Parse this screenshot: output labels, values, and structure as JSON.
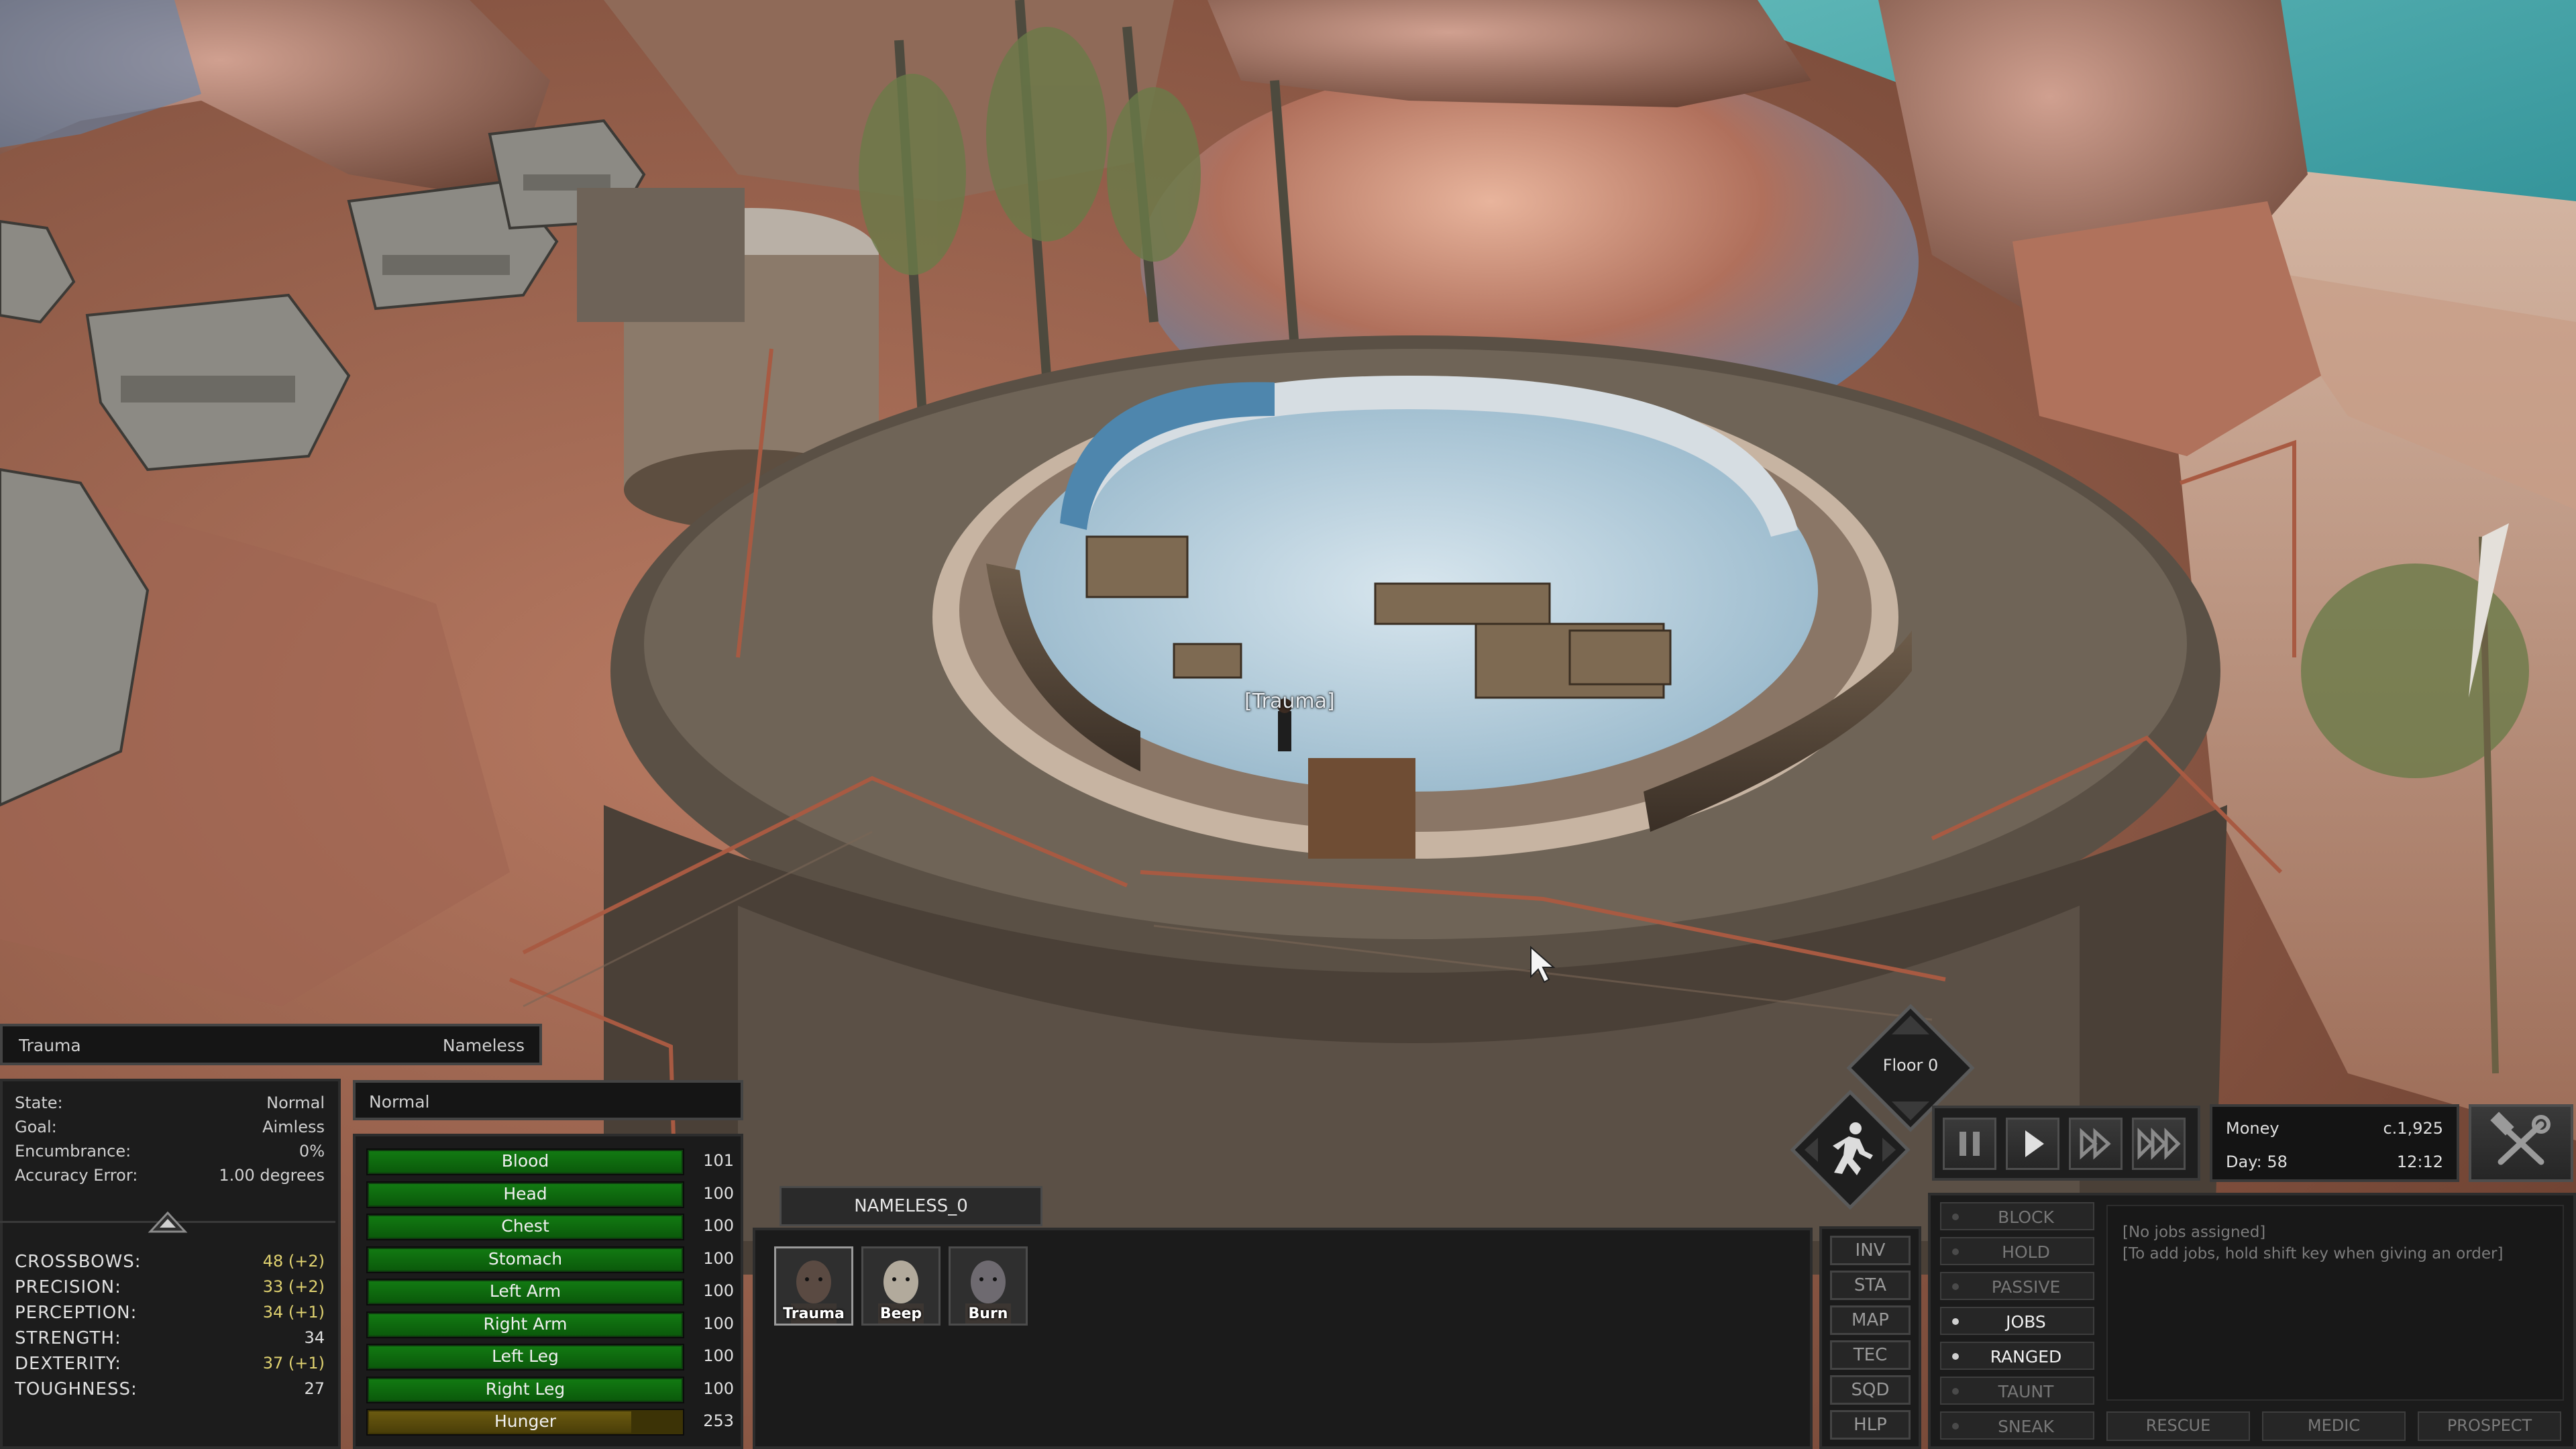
{
  "world": {
    "hover_label": "[Trauma]"
  },
  "character": {
    "name": "Trauma",
    "faction": "Nameless",
    "stats": [
      {
        "key": "State:",
        "value": "Normal"
      },
      {
        "key": "Goal:",
        "value": "Aimless"
      },
      {
        "key": "Encumbrance:",
        "value": "0%"
      },
      {
        "key": "Accuracy Error:",
        "value": "1.00 degrees"
      }
    ],
    "skills": [
      {
        "key": "CROSSBOWS:",
        "value": "48 (+2)",
        "bonus": true
      },
      {
        "key": "PRECISION:",
        "value": "33 (+2)",
        "bonus": true
      },
      {
        "key": "PERCEPTION:",
        "value": "34 (+1)",
        "bonus": true
      },
      {
        "key": "STRENGTH:",
        "value": "34",
        "bonus": false
      },
      {
        "key": "DEXTERITY:",
        "value": "37 (+1)",
        "bonus": true
      },
      {
        "key": "TOUGHNESS:",
        "value": "27",
        "bonus": false
      }
    ]
  },
  "health": {
    "status": "Normal",
    "parts": [
      {
        "name": "Blood",
        "value": "101",
        "fill": 1.0
      },
      {
        "name": "Head",
        "value": "100",
        "fill": 1.0
      },
      {
        "name": "Chest",
        "value": "100",
        "fill": 1.0
      },
      {
        "name": "Stomach",
        "value": "100",
        "fill": 1.0
      },
      {
        "name": "Left Arm",
        "value": "100",
        "fill": 1.0
      },
      {
        "name": "Right Arm",
        "value": "100",
        "fill": 1.0
      },
      {
        "name": "Left Leg",
        "value": "100",
        "fill": 1.0
      },
      {
        "name": "Right Leg",
        "value": "100",
        "fill": 1.0
      }
    ],
    "hunger": {
      "name": "Hunger",
      "value": "253",
      "fill": 0.84
    }
  },
  "squad": {
    "name": "NAMELESS_0",
    "members": [
      "Trauma",
      "Beep",
      "Burn"
    ],
    "selected": 0
  },
  "menu": [
    "INV",
    "STA",
    "MAP",
    "TEC",
    "SQD",
    "HLP"
  ],
  "floor": {
    "label": "Floor 0"
  },
  "economy": {
    "money_label": "Money",
    "money_value": "c.1,925",
    "day": "Day: 58",
    "time": "12:12"
  },
  "orders": [
    {
      "label": "BLOCK",
      "on": false
    },
    {
      "label": "HOLD",
      "on": false
    },
    {
      "label": "PASSIVE",
      "on": false
    },
    {
      "label": "JOBS",
      "on": true
    },
    {
      "label": "RANGED",
      "on": true
    },
    {
      "label": "TAUNT",
      "on": false
    },
    {
      "label": "SNEAK",
      "on": false
    }
  ],
  "jobs": {
    "line1": "[No jobs assigned]",
    "line2": "[To add jobs, hold shift key when giving an order]"
  },
  "actions": [
    "RESCUE",
    "MEDIC",
    "PROSPECT"
  ],
  "colors": {
    "health_green": "#127a12",
    "hunger_yellow": "#6b5a10",
    "bonus_yellow": "#e0d270"
  }
}
